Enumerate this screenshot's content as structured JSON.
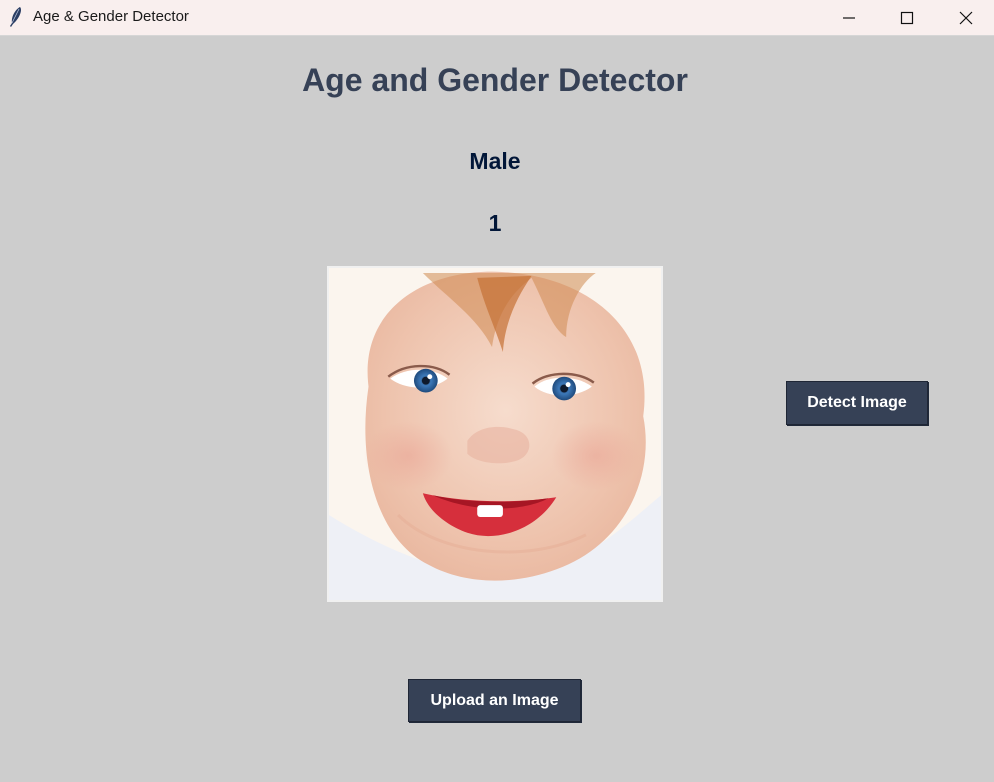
{
  "window": {
    "title": "Age & Gender Detector"
  },
  "main": {
    "heading": "Age and Gender Detector",
    "gender_result": "Male",
    "age_result": "1"
  },
  "buttons": {
    "detect_label": "Detect Image",
    "upload_label": "Upload an Image"
  },
  "colors": {
    "background": "#cdcdcd",
    "titlebar": "#f9efee",
    "heading": "#364156",
    "result_text": "#011638",
    "button_bg": "#364156",
    "button_text": "#ffffff"
  },
  "icons": {
    "app": "feather-icon",
    "minimize": "minimize-icon",
    "maximize": "maximize-icon",
    "close": "close-icon"
  }
}
